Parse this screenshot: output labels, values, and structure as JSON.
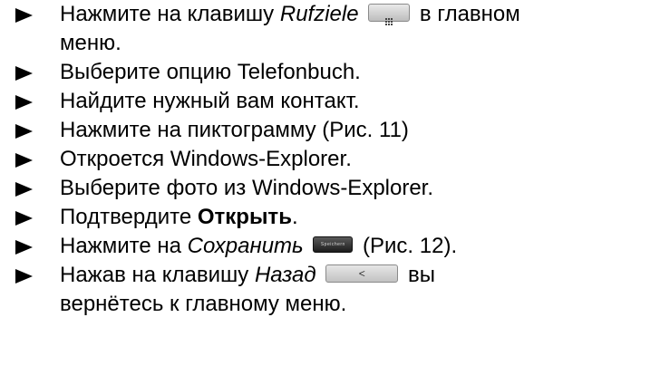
{
  "steps": [
    {
      "text_1": "Нажмите на клавишу ",
      "italic": "Rufziele",
      "text_2": " в главном",
      "icon": "menu-grid-icon"
    },
    {
      "text": "меню."
    },
    {
      "text": "Выберите опцию Telefonbuch."
    },
    {
      "text": "Найдите нужный вам контакт."
    },
    {
      "text": "Нажмите на пиктограмму (Рис. 11)"
    },
    {
      "text": "Откроется Windows-Explorer."
    },
    {
      "text": "Выберите фото из Windows-Explorer."
    },
    {
      "text_1": "Подтвердите ",
      "bold": "Открыть",
      "text_2": "."
    },
    {
      "text_1": "Нажмите на ",
      "italic": "Сохранить",
      "button_label": "Speichern",
      "text_2": " (Рис. 12)."
    },
    {
      "text_1": "Нажав на клавишу ",
      "italic": "Назад",
      "button_label": "<",
      "text_2": " вы"
    },
    {
      "text": "вернётесь к главному меню."
    }
  ]
}
